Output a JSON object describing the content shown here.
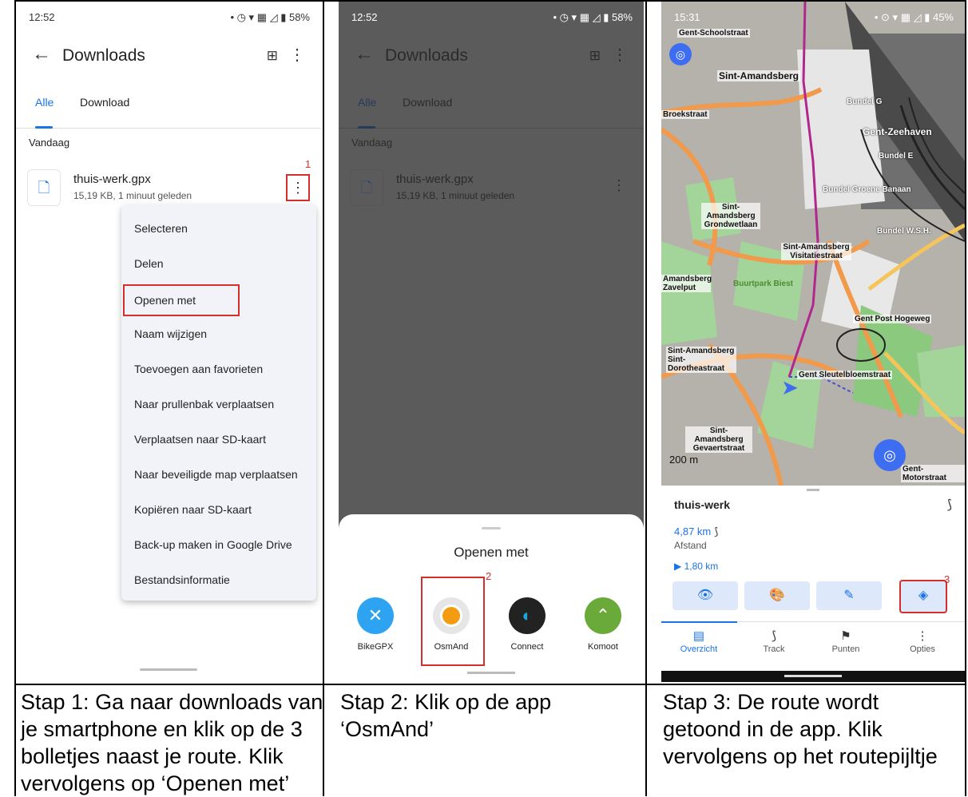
{
  "phone1": {
    "status_time": "12:52",
    "status_battery": "58%",
    "title": "Downloads",
    "tabs": [
      "Alle",
      "Download"
    ],
    "section": "Vandaag",
    "file_name": "thuis-werk.gpx",
    "file_meta": "15,19 KB, 1 minuut geleden",
    "step_number": "1",
    "menu": [
      "Selecteren",
      "Delen",
      "Openen met",
      "Naam wijzigen",
      "Toevoegen aan favorieten",
      "Naar prullenbak verplaatsen",
      "Verplaatsen naar SD-kaart",
      "Naar beveiligde map verplaatsen",
      "Kopiëren naar SD-kaart",
      "Back-up maken in Google Drive",
      "Bestandsinformatie"
    ]
  },
  "phone2": {
    "status_time": "12:52",
    "status_battery": "58%",
    "title": "Downloads",
    "tabs": [
      "Alle",
      "Download"
    ],
    "section": "Vandaag",
    "file_name": "thuis-werk.gpx",
    "file_meta": "15,19 KB, 1 minuut geleden",
    "sheet_title": "Openen met",
    "step_number": "2",
    "apps": [
      "BikeGPX",
      "OsmAnd",
      "Connect",
      "Komoot"
    ]
  },
  "phone3": {
    "status_time": "15:31",
    "status_battery": "45%",
    "map_labels": {
      "schoolstraat": "Gent-Schoolstraat",
      "amandsberg": "Sint-Amandsberg",
      "broekstraat": "Broekstraat",
      "bundel_g": "Bundel G",
      "zeehaven": "Gent-Zeehaven",
      "bundel_e": "Bundel E",
      "groene_banaan": "Bundel Groene Banaan",
      "grondwetlaan": "Sint-Amandsberg Grondwetlaan",
      "bundel_wsh": "Bundel W.S.H.",
      "visitatie": "Sint-Amandsberg Visitatiestraat",
      "zavelput": "Amandsberg Zavelput",
      "buurtpark": "Buurtpark Biest",
      "post_hogeweg": "Gent Post Hogeweg",
      "dorothea": "Sint-Amandsberg Sint-Dorotheastraat",
      "sleutelbloem": "Gent Sleutelbloemstraat",
      "gevaert": "Sint-Amandsberg Gevaertstraat",
      "motorstraat": "Gent-Motorstraat"
    },
    "scale": "200 m",
    "route_name": "thuis-werk",
    "distance": "4,87 km",
    "distance_label": "Afstand",
    "segment": "1,80 km",
    "step_number": "3",
    "nav": [
      "Overzicht",
      "Track",
      "Punten",
      "Opties"
    ]
  },
  "captions": [
    [
      "Stap 1: Ga naar downloads van",
      "je smartphone en klik op de 3",
      "bolletjes naast je route. Klik",
      "vervolgens op ‘Openen met’"
    ],
    [
      "Stap 2: Klik op de app",
      "‘OsmAnd’"
    ],
    [
      "Stap 3: De route wordt",
      "getoond in de app. Klik",
      "vervolgens op het routepijltje"
    ]
  ],
  "colors": {
    "accent": "#1a73e8",
    "highlight": "#d32f2f",
    "osmand_orange": "#f39c12",
    "komoot_green": "#6aaa3a",
    "bikegpx_blue": "#2ea3f2"
  }
}
